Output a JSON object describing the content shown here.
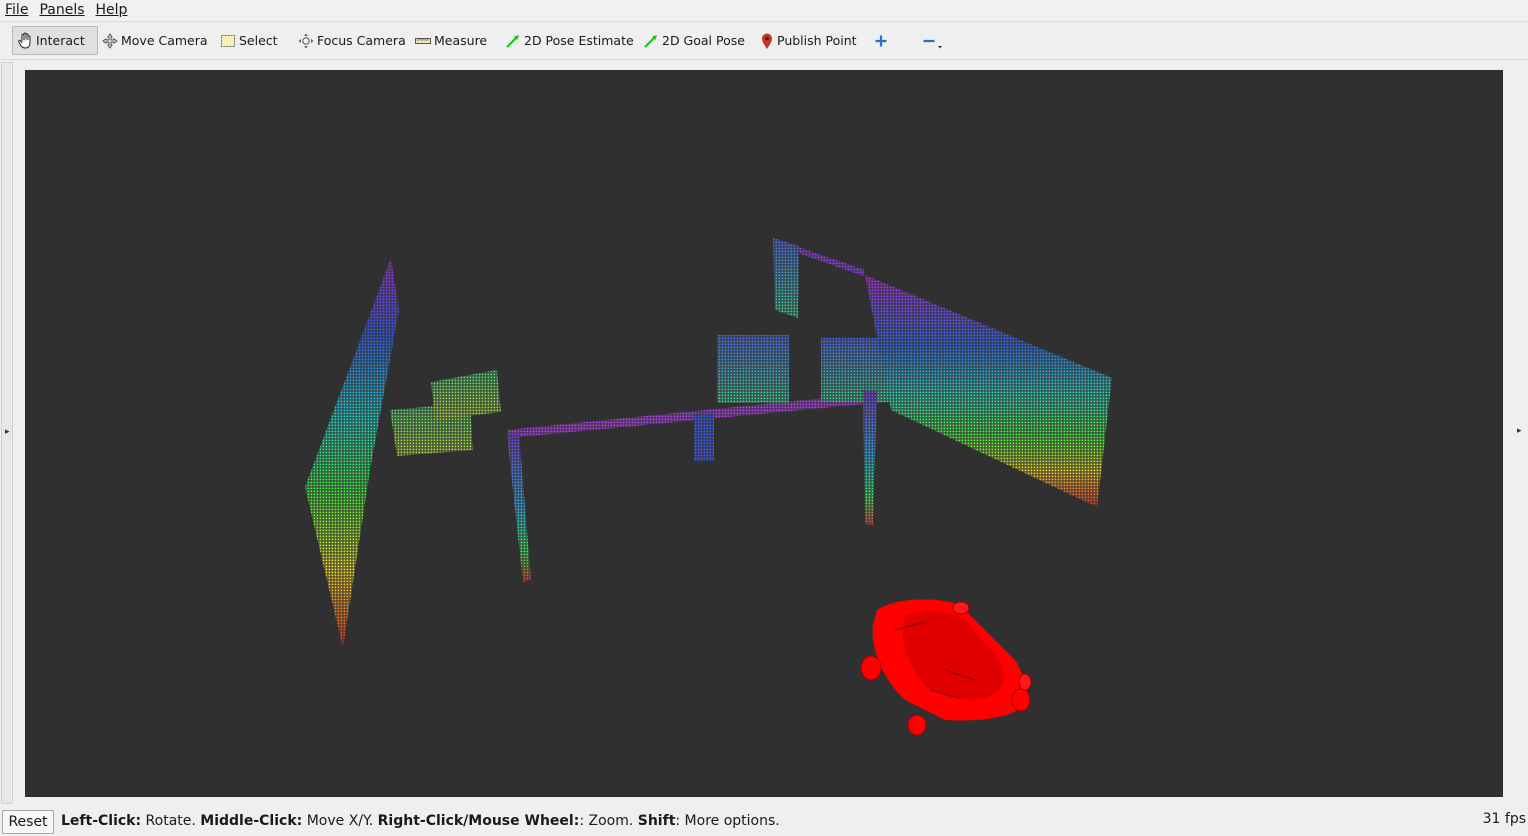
{
  "menu": {
    "file": "File",
    "panels": "Panels",
    "help": "Help"
  },
  "toolbar": {
    "interact": "Interact",
    "move_camera": "Move Camera",
    "select": "Select",
    "focus_camera": "Focus Camera",
    "measure": "Measure",
    "pose_estimate": "2D Pose Estimate",
    "goal_pose": "2D Goal Pose",
    "publish_point": "Publish Point"
  },
  "status": {
    "reset": "Reset",
    "left_click_key": "Left-Click:",
    "left_click_text": " Rotate. ",
    "middle_click_key": "Middle-Click:",
    "middle_click_text": " Move X/Y. ",
    "right_click_key": "Right-Click/Mouse Wheel:",
    "right_click_text": ": Zoom. ",
    "shift_key": "Shift",
    "shift_text": ": More options.",
    "fps": "31 fps"
  },
  "colors": {
    "viewport_bg": "#303030",
    "robot": "#ff0000",
    "pose_arrow": "#22cc22",
    "publish_point_pin": "#c0392b",
    "plus_minus": "#2a6fc9"
  },
  "icons": {
    "interact": "hand-icon",
    "move_camera": "move-camera-icon",
    "select": "select-box-icon",
    "focus_camera": "focus-crosshair-icon",
    "measure": "ruler-icon",
    "pose_estimate": "green-arrow-icon",
    "goal_pose": "green-arrow-icon",
    "publish_point": "map-pin-icon",
    "add_tool": "plus-icon",
    "remove_tool": "minus-icon"
  }
}
